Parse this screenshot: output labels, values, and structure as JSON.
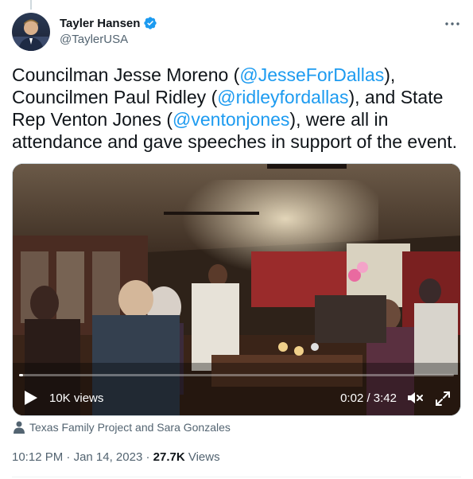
{
  "author": {
    "name": "Tayler Hansen",
    "handle": "@TaylerUSA"
  },
  "tweet": {
    "segments": [
      {
        "text": "Councilman Jesse Moreno (",
        "mention": false
      },
      {
        "text": "@JesseForDallas",
        "mention": true
      },
      {
        "text": "), Councilmen Paul Ridley (",
        "mention": false
      },
      {
        "text": "@ridleyfordallas",
        "mention": true
      },
      {
        "text": "), and State Rep Venton Jones (",
        "mention": false
      },
      {
        "text": "@ventonjones",
        "mention": true
      },
      {
        "text": "), were all in attendance and gave speeches in support of the event.",
        "mention": false
      }
    ]
  },
  "video": {
    "views": "10K views",
    "time": "0:02 / 3:42",
    "progress": 0.01
  },
  "attribution": "Texas Family Project and Sara Gonzales",
  "meta": {
    "time": "10:12 PM",
    "date": "Jan 14, 2023",
    "separator": "·",
    "views_count": "27.7K",
    "views_label": "Views"
  },
  "colors": {
    "mention": "#1d9bf0",
    "secondary_text": "#536471",
    "verified": "#1d9bf0"
  },
  "icons": [
    "verified-badge-icon",
    "more-icon",
    "play-icon",
    "mute-icon",
    "fullscreen-icon",
    "person-icon"
  ]
}
